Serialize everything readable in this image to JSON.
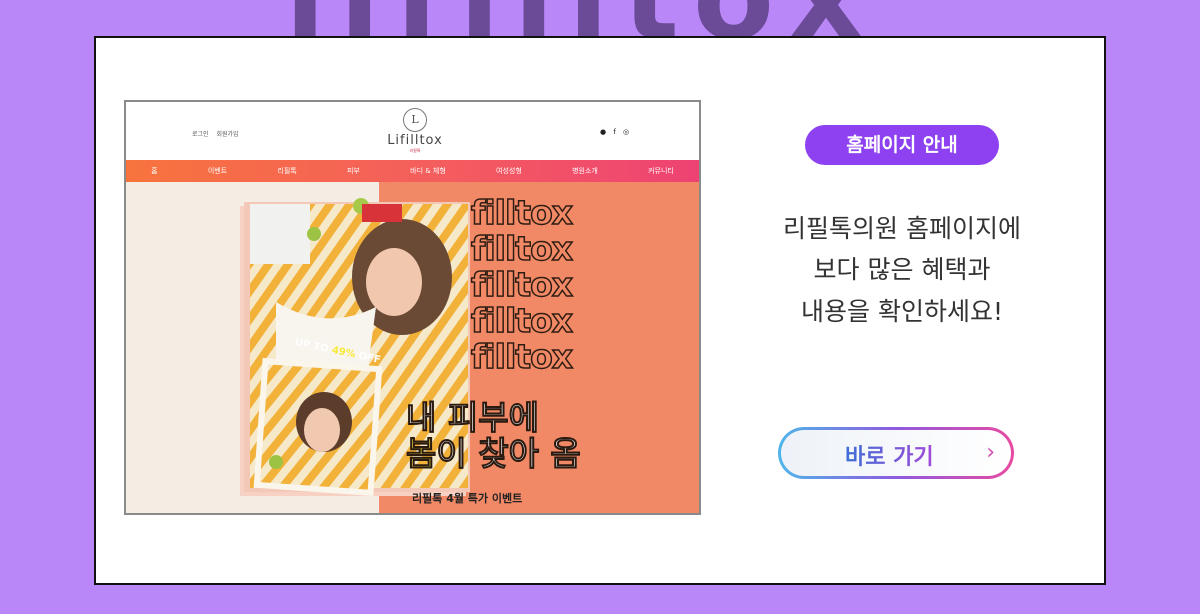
{
  "background_word": "lifilltox",
  "site": {
    "top_links": [
      "로그인",
      "회원가입"
    ],
    "logo_mark": "L",
    "logo_text": "Lifilltox",
    "logo_sub": "리필톡",
    "social_icons": [
      "instagram-icon",
      "facebook-icon",
      "kakao-icon"
    ],
    "nav": [
      "홈",
      "이벤트",
      "리필톡",
      "피부",
      "바디 & 체형",
      "여성성형",
      "병원소개",
      "커뮤니티"
    ]
  },
  "hero": {
    "repeat_word": "filltox",
    "promo_prefix": "UP TO ",
    "promo_value": "49%",
    "promo_suffix": " OFF",
    "headline_line1": "내 피부에",
    "headline_bom": "봄",
    "headline_line2_rest": "이 찾아 옴",
    "caption": "리필톡 4월 특가 이벤트"
  },
  "panel": {
    "badge": "홈페이지 안내",
    "desc_line1": "리필톡의원 홈페이지에",
    "desc_line2": "보다 많은 혜택과",
    "desc_line3": "내용을 확인하세요!",
    "button_label": "바로 가기",
    "button_arrow": "›"
  },
  "colors": {
    "page_bg": "#b987f7",
    "badge": "#8d41f0",
    "nav_start": "#f7743d",
    "nav_end": "#ee4273",
    "hero_right": "#f28966"
  }
}
